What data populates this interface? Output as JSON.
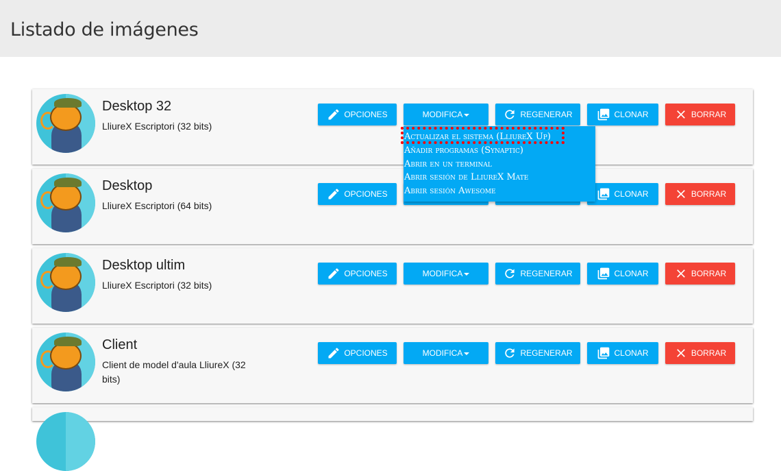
{
  "page": {
    "title": "Listado de imágenes"
  },
  "buttons": {
    "options": "OPCIONES",
    "modify": "MODIFICA",
    "regenerate": "REGENERAR",
    "clone": "CLONAR",
    "delete": "BORRAR"
  },
  "images": [
    {
      "title": "Desktop 32",
      "description": "LliureX Escriptori (32 bits)"
    },
    {
      "title": "Desktop",
      "description": "LliureX Escriptori (64 bits)"
    },
    {
      "title": "Desktop ultim",
      "description": "LliureX Escriptori (32 bits)"
    },
    {
      "title": "Client",
      "description": "Client de model d'aula LliureX (32 bits)"
    }
  ],
  "dropdown_menu": {
    "items": [
      "Actualizar el sistema (LliureX Up)",
      "Añadir programas (Synaptic)",
      "Abrir en un terminal",
      "Abrir sesión de LliureX Mate",
      "Abrir sesión Awesome"
    ]
  },
  "colors": {
    "primary": "#03a9f4",
    "danger": "#f44336",
    "header_bg": "#ececec",
    "highlight": "#ff0000"
  }
}
